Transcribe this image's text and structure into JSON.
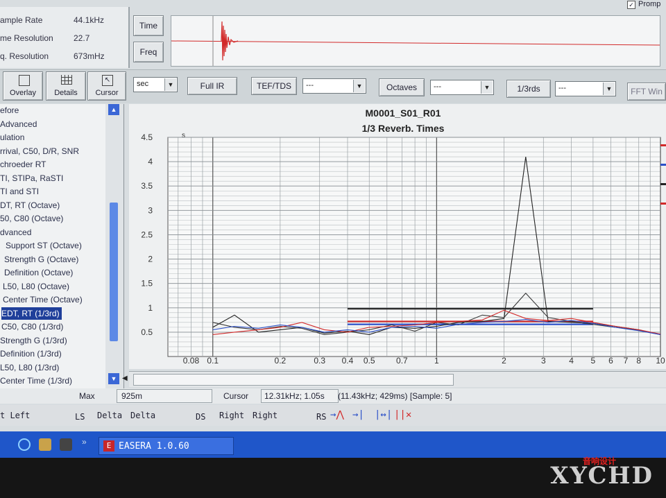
{
  "info": [
    {
      "label": "ample Rate",
      "value": "44.1kHz"
    },
    {
      "label": "me Resolution",
      "value": "22.7"
    },
    {
      "label": "q. Resolution",
      "value": "673mHz"
    }
  ],
  "view_buttons": {
    "time": "Time",
    "freq": "Freq"
  },
  "prompt_label": "Promp",
  "tools": {
    "overlay": "Overlay",
    "details": "Details",
    "cursor": "Cursor"
  },
  "toolbar": {
    "unit_select": "sec",
    "full_ir": "Full IR",
    "tef_tds": "TEF/TDS",
    "tef_select": "---",
    "octaves": "Octaves",
    "octaves_select": "---",
    "thirds": "1/3rds",
    "thirds_select": "---",
    "fft": "FFT Win"
  },
  "tree": [
    {
      "label": "efore",
      "indent": 0
    },
    {
      "label": "Advanced",
      "indent": 0
    },
    {
      "label": "ulation",
      "indent": 0
    },
    {
      "label": "rrival, C50, D/R, SNR",
      "indent": 0
    },
    {
      "label": "chroeder RT",
      "indent": 0
    },
    {
      "label": "TI, STIPa, RaSTI",
      "indent": 0
    },
    {
      "label": "TI and STI",
      "indent": 0
    },
    {
      "label": "DT, RT (Octave)",
      "indent": 0
    },
    {
      "label": "50, C80 (Octave)",
      "indent": 0
    },
    {
      "label": "dvanced",
      "indent": 0
    },
    {
      "label": "Support ST (Octave)",
      "indent": 8
    },
    {
      "label": "Strength G (Octave)",
      "indent": 6
    },
    {
      "label": "Definition (Octave)",
      "indent": 6
    },
    {
      "label": "L50, L80 (Octave)",
      "indent": 4
    },
    {
      "label": "Center Time (Octave)",
      "indent": 4
    },
    {
      "label": "EDT, RT (1/3rd)",
      "indent": 2,
      "selected": true
    },
    {
      "label": "C50, C80 (1/3rd)",
      "indent": 2
    },
    {
      "label": "Strength G (1/3rd)",
      "indent": 0
    },
    {
      "label": "Definition (1/3rd)",
      "indent": 0
    },
    {
      "label": "L50, L80 (1/3rd)",
      "indent": 0
    },
    {
      "label": "Center Time (1/3rd)",
      "indent": 0
    }
  ],
  "status": {
    "max_label": "Max",
    "max_value": "925m",
    "cursor_label": "Cursor",
    "cursor_value": "12.31kHz; 1.05s",
    "cursor_extra": "(11.43kHz; 429ms) [Sample: 5]"
  },
  "status2": {
    "left_a": "t Left",
    "ls": "LS",
    "delta_a": "Delta",
    "delta_b": "Delta",
    "ds": "DS",
    "right_a": "Right",
    "right_b": "Right",
    "rs": "RS"
  },
  "taskbar": {
    "app": "EASERA 1.0.60"
  },
  "watermark": {
    "text": "XYCHD",
    "cn": "音响设计"
  },
  "colors": {
    "red": "#d22a2a",
    "blue": "#2b50c8",
    "black": "#222222",
    "selection": "#1f3f9a",
    "taskbar": "#1f56c9"
  },
  "chart_data": {
    "type": "line",
    "title": "M0001_S01_R01",
    "subtitle": "1/3 Reverb. Times",
    "ylabel": "s",
    "xscale": "log",
    "xlim": [
      0.063,
      10
    ],
    "ylim": [
      0,
      4.5
    ],
    "xticks": [
      {
        "v": 0.08,
        "t": "0.08"
      },
      {
        "v": 0.1,
        "t": "0.1"
      },
      {
        "v": 0.2,
        "t": "0.2"
      },
      {
        "v": 0.3,
        "t": "0.3"
      },
      {
        "v": 0.4,
        "t": "0.4"
      },
      {
        "v": 0.5,
        "t": "0.5"
      },
      {
        "v": 0.7,
        "t": "0.7"
      },
      {
        "v": 1,
        "t": "1"
      },
      {
        "v": 2,
        "t": "2"
      },
      {
        "v": 3,
        "t": "3"
      },
      {
        "v": 4,
        "t": "4"
      },
      {
        "v": 5,
        "t": "5"
      },
      {
        "v": 6,
        "t": "6"
      },
      {
        "v": 7,
        "t": "7"
      },
      {
        "v": 8,
        "t": "8"
      },
      {
        "v": 10,
        "t": "10"
      }
    ],
    "yticks": [
      0.5,
      1,
      1.5,
      2,
      2.5,
      3,
      3.5,
      4,
      4.5
    ],
    "grid": true,
    "series": [
      {
        "color": "#222222",
        "x": [
          0.1,
          0.125,
          0.16,
          0.2,
          0.25,
          0.315,
          0.4,
          0.5,
          0.63,
          0.8,
          1,
          1.25,
          1.6,
          2,
          2.5,
          3.15,
          4,
          5,
          6.3,
          8,
          10
        ],
        "y": [
          0.6,
          0.85,
          0.5,
          0.55,
          0.6,
          0.48,
          0.52,
          0.45,
          0.6,
          0.58,
          0.62,
          0.7,
          0.72,
          0.78,
          4.1,
          0.72,
          0.7,
          0.68,
          0.62,
          0.55,
          0.45
        ]
      },
      {
        "color": "#3a3a3a",
        "x": [
          0.1,
          0.125,
          0.16,
          0.2,
          0.25,
          0.315,
          0.4,
          0.5,
          0.63,
          0.8,
          1,
          1.25,
          1.6,
          2,
          2.5,
          3.15,
          4,
          5,
          6.3,
          8,
          10
        ],
        "y": [
          0.7,
          0.6,
          0.55,
          0.62,
          0.58,
          0.45,
          0.5,
          0.55,
          0.65,
          0.52,
          0.7,
          0.65,
          0.85,
          0.8,
          1.3,
          0.8,
          0.72,
          0.66,
          0.6,
          0.54,
          0.45
        ]
      },
      {
        "color": "#d22a2a",
        "x": [
          0.1,
          0.125,
          0.16,
          0.2,
          0.25,
          0.315,
          0.4,
          0.5,
          0.63,
          0.8,
          1,
          1.25,
          1.6,
          2,
          2.5,
          3.15,
          4,
          5,
          6.3,
          8,
          10
        ],
        "y": [
          0.45,
          0.5,
          0.55,
          0.6,
          0.7,
          0.55,
          0.5,
          0.6,
          0.62,
          0.65,
          0.7,
          0.72,
          0.75,
          0.95,
          0.78,
          0.74,
          0.78,
          0.7,
          0.62,
          0.55,
          0.46
        ]
      },
      {
        "color": "#2b50c8",
        "x": [
          0.1,
          0.125,
          0.16,
          0.2,
          0.25,
          0.315,
          0.4,
          0.5,
          0.63,
          0.8,
          1,
          1.25,
          1.6,
          2,
          2.5,
          3.15,
          4,
          5,
          6.3,
          8,
          10
        ],
        "y": [
          0.55,
          0.62,
          0.58,
          0.65,
          0.6,
          0.5,
          0.55,
          0.5,
          0.6,
          0.62,
          0.58,
          0.66,
          0.7,
          0.72,
          0.76,
          0.7,
          0.74,
          0.68,
          0.6,
          0.53,
          0.45
        ]
      }
    ],
    "averages": [
      {
        "color": "#222222",
        "from": 0.4,
        "to": 5,
        "y": 0.98
      },
      {
        "color": "#d22a2a",
        "from": 0.4,
        "to": 5,
        "y": 0.72
      },
      {
        "color": "#2b50c8",
        "from": 0.4,
        "to": 5,
        "y": 0.66
      }
    ]
  }
}
